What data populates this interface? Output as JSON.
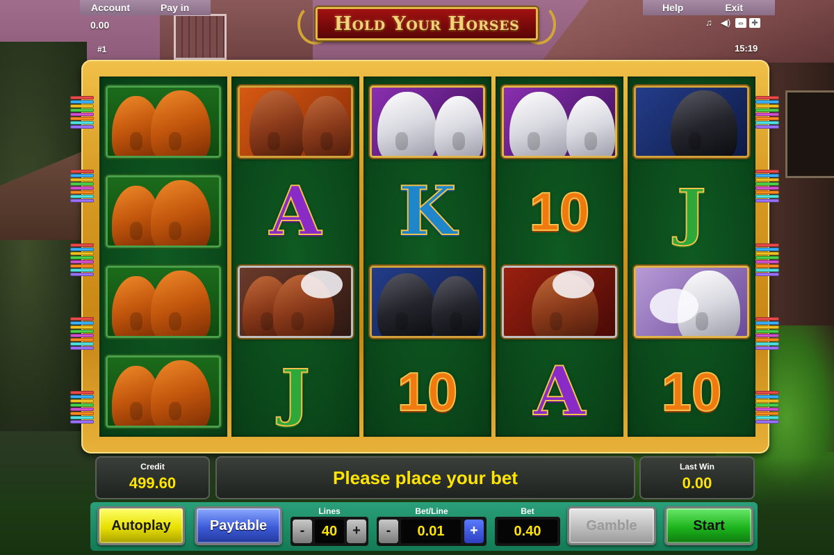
{
  "topbar": {
    "account_label": "Account",
    "payin_label": "Pay in",
    "help_label": "Help",
    "exit_label": "Exit",
    "credit_display": "0.00",
    "game_number": "#1",
    "clock": "15:19"
  },
  "icons": [
    "music-icon",
    "sound-icon",
    "fullscreen-icon",
    "settings-icon"
  ],
  "logo": {
    "title": "Hold Your Horses"
  },
  "reels": [
    [
      "chestnut-pair",
      "chestnut-pair",
      "chestnut-pair",
      "chestnut-pair"
    ],
    [
      "orange-pair",
      "A",
      "bay-white-mane-pair",
      "J"
    ],
    [
      "white-pair",
      "K",
      "black-pair",
      "10"
    ],
    [
      "white-pair",
      "10",
      "bay-white-mane",
      "A"
    ],
    [
      "black-single",
      "J",
      "white-single",
      "10"
    ]
  ],
  "panel": {
    "credit_label": "Credit",
    "credit_value": "499.60",
    "message": "Please place your bet",
    "last_win_label": "Last Win",
    "last_win_value": "0.00"
  },
  "controls": {
    "autoplay_label": "Autoplay",
    "paytable_label": "Paytable",
    "lines_label": "Lines",
    "lines_value": "40",
    "betline_label": "Bet/Line",
    "betline_value": "0.01",
    "bet_label": "Bet",
    "bet_value": "0.40",
    "gamble_label": "Gamble",
    "start_label": "Start",
    "minus": "-",
    "plus": "+"
  },
  "colors": {
    "frame_gold": "#d89b22",
    "reel_green": "#0b4a1b",
    "value_yellow": "#ffe400",
    "marker_colors": [
      "#e84a4a",
      "#3ab0ff",
      "#f0c020",
      "#4ad04a",
      "#d050d0",
      "#ff8a20",
      "#50e0e0",
      "#9a70ff"
    ]
  }
}
